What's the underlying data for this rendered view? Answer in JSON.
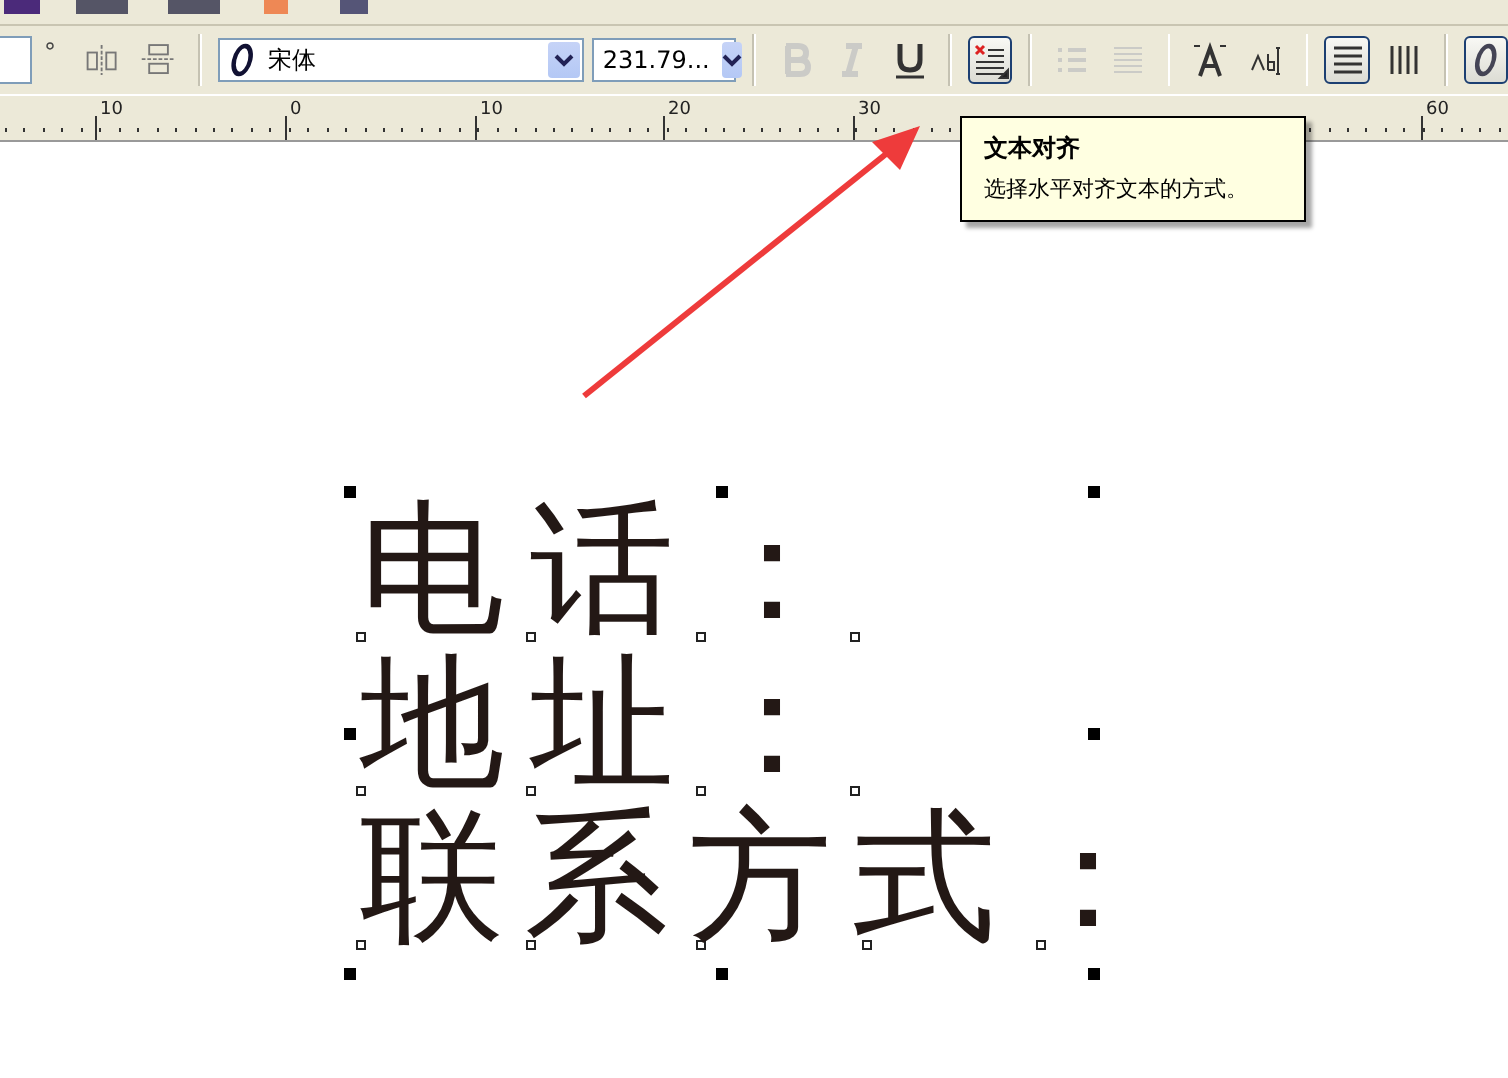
{
  "property_bar": {
    "angle_unit": "°",
    "font": {
      "name": "宋体"
    },
    "font_size": "231.79...",
    "tools": [
      {
        "kind": "mirror-h"
      },
      {
        "kind": "mirror-v"
      },
      {
        "kind": "sep"
      },
      {
        "kind": "bold",
        "disabled": true,
        "pressed": false
      },
      {
        "kind": "italic",
        "disabled": true,
        "pressed": false
      },
      {
        "kind": "underline",
        "disabled": false,
        "pressed": false
      },
      {
        "kind": "sep"
      },
      {
        "kind": "align",
        "disabled": false,
        "pressed": true
      },
      {
        "kind": "sep"
      },
      {
        "kind": "bullets",
        "disabled": true,
        "pressed": false
      },
      {
        "kind": "dropcap",
        "disabled": true,
        "pressed": false
      },
      {
        "kind": "sep"
      },
      {
        "kind": "charformat",
        "disabled": false,
        "pressed": false
      },
      {
        "kind": "edittext",
        "disabled": false,
        "pressed": false
      },
      {
        "kind": "sep"
      },
      {
        "kind": "horizontal",
        "disabled": false,
        "pressed": true
      },
      {
        "kind": "vertical",
        "disabled": false,
        "pressed": false
      },
      {
        "kind": "sep"
      },
      {
        "kind": "opentype",
        "disabled": false,
        "pressed": true
      }
    ]
  },
  "ruler": {
    "labels": [
      "10",
      "0",
      "10",
      "20",
      "30",
      "60"
    ]
  },
  "tooltip": {
    "title": "文本对齐",
    "text": "选择水平对齐文本的方式。"
  },
  "canvas": {
    "lines": [
      "电话：",
      "地址：",
      "联系方式："
    ]
  }
}
